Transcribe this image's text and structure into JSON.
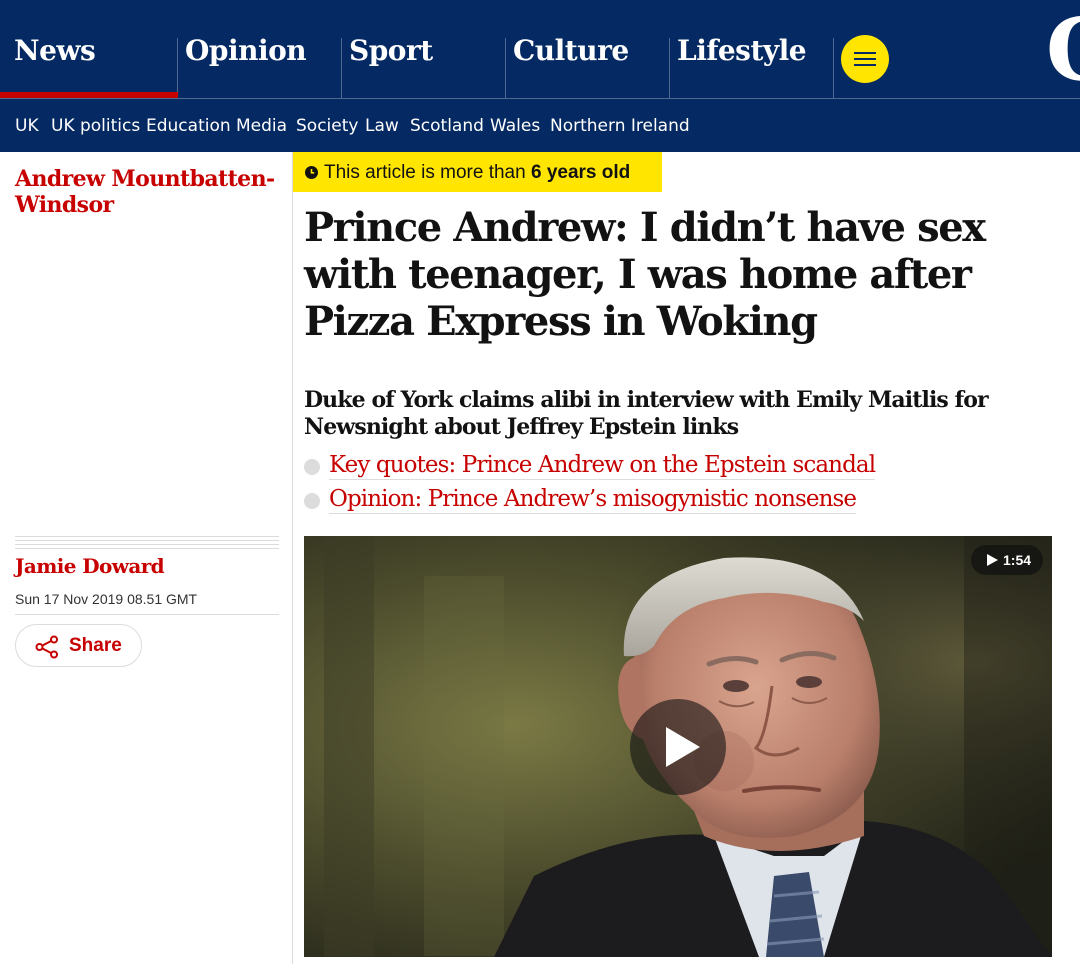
{
  "nav": {
    "pillars": [
      {
        "label": "News",
        "active": true
      },
      {
        "label": "Opinion",
        "active": false
      },
      {
        "label": "Sport",
        "active": false
      },
      {
        "label": "Culture",
        "active": false
      },
      {
        "label": "Lifestyle",
        "active": false
      }
    ],
    "menu_icon": "hamburger-menu-icon",
    "logo_glyph": "G",
    "colors": {
      "brand_navy": "#052962",
      "menu_yellow": "#ffe500",
      "news_red": "#c70000"
    }
  },
  "subnav": {
    "items": [
      "UK",
      "UK politics",
      "Education",
      "Media",
      "Society",
      "Law",
      "Scotland",
      "Wales",
      "Northern Ireland"
    ]
  },
  "sidebar": {
    "series": "Andrew Mountbatten-Windsor",
    "author": "Jamie Doward",
    "date": "Sun 17 Nov 2019 08.51 GMT",
    "share_label": "Share",
    "share_icon": "share-icon"
  },
  "article": {
    "age_warning": {
      "prefix": "This article is more than ",
      "age": "6 years old",
      "icon": "clock-icon"
    },
    "headline": "Prince Andrew: I didn’t have sex with teenager, I was home after Pizza Express in Woking",
    "standfirst": "Duke of York claims alibi in interview with Emily Maitlis for Newsnight about Jeffrey Epstein links",
    "related": [
      "Key quotes: Prince Andrew on the Epstein scandal",
      "Opinion: Prince Andrew’s misogynistic nonsense"
    ]
  },
  "video": {
    "duration": "1:54",
    "play_icon": "play-icon"
  }
}
